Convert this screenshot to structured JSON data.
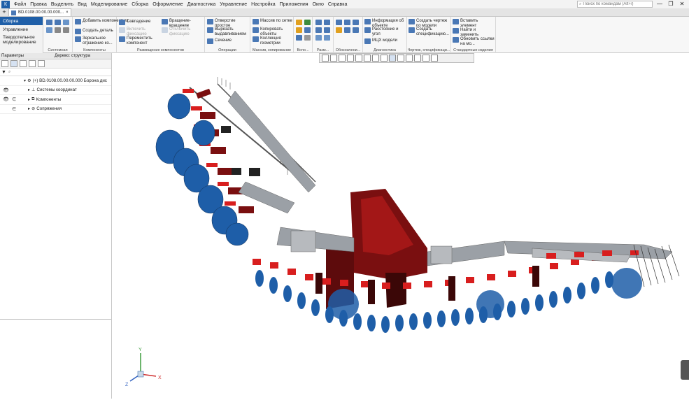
{
  "app": {
    "logo": "К"
  },
  "menu": [
    "Файл",
    "Правка",
    "Выделить",
    "Вид",
    "Моделирование",
    "Сборка",
    "Оформление",
    "Диагностика",
    "Управление",
    "Настройка",
    "Приложения",
    "Окно",
    "Справка"
  ],
  "search": {
    "placeholder": "Поиск по командам (Alt+/)"
  },
  "window_controls": [
    "—",
    "❐",
    "✕"
  ],
  "tab": {
    "label": "BD.0108.00.00.00.000...",
    "close": "×"
  },
  "ribbon_modes": [
    "Сборка",
    "Управление",
    "Твердотельное моделирование"
  ],
  "ribbon": {
    "components": {
      "add": "Добавить компонент из...",
      "create": "Создать деталь",
      "mirror": "Зеркальное отражение ко..."
    },
    "placement": {
      "coincidence": "Совпадение",
      "enable_fix": "Включить фиксацию",
      "move": "Переместить компонент",
      "rotate": "Вращение-вращение",
      "disable_fix": "Отключить фиксацию"
    },
    "operations": {
      "simple_hole": "Отверстие простое",
      "cut_extrude": "Вырезать выдавливанием",
      "section": "Сечение"
    },
    "arrays": {
      "grid": "Массив по сетке",
      "copy": "Копировать объекты",
      "collection": "Коллекция геометрии"
    },
    "diagnostics": {
      "info": "Информация об объекте",
      "distance": "Расстояние и угол",
      "mcx": "МЦХ модели"
    },
    "drawing": {
      "create_drawing": "Создать чертеж по модели",
      "create_spec": "Создать спецификацию..."
    },
    "standard": {
      "insert": "Вставить элемент",
      "find_replace": "Найти и заменить",
      "update_links": "Обновить ссылки на мо..."
    }
  },
  "groups": {
    "system": "Системная",
    "components": "Компоненты",
    "placement": "Размещение компонентов",
    "operations": "Операции",
    "arrays": "Массив, копирование",
    "aux": "Вспо...",
    "sizes": "Разм...",
    "designations": "Обозначени...",
    "diagnostics": "Диагностика",
    "drawing": "Чертеж, спецификаци...",
    "standard": "Стандартные изделия"
  },
  "panel": {
    "params_label": "Параметры",
    "tree_label": "Дерево: структура",
    "filter_icon": "▼",
    "search_glyph": "⌕",
    "root": "(+) BD.0108.00.00.00.000 Борона дис",
    "items": [
      "Системы координат",
      "Компоненты",
      "Сопряжения"
    ]
  },
  "axes": {
    "x": "X",
    "y": "Y",
    "z": "Z"
  },
  "colors": {
    "accent": "#1f5fa8",
    "part_red": "#d81e1e",
    "part_blue": "#1e5ea8",
    "frame_gray": "#9ba0a6",
    "dark_red": "#7a0f10"
  }
}
